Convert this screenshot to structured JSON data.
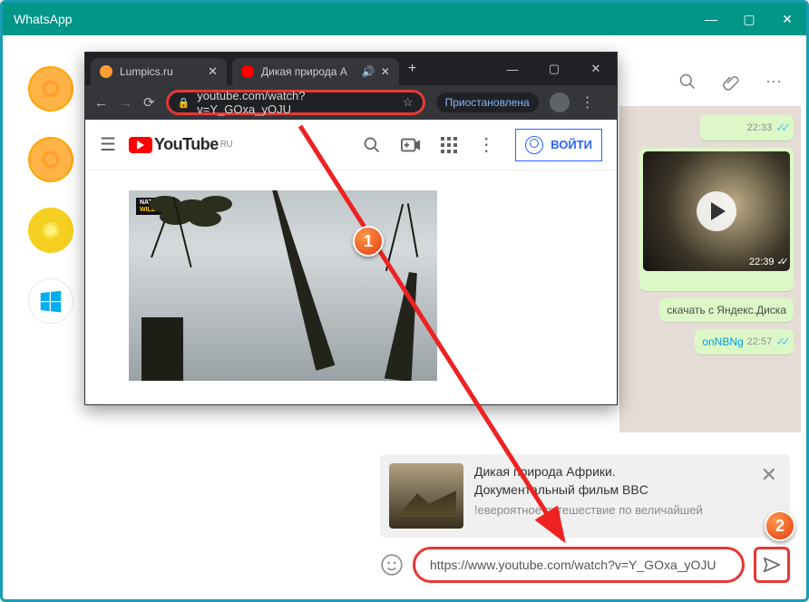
{
  "whatsapp": {
    "title": "WhatsApp",
    "top_icons": {
      "search": "search-icon",
      "attach": "paperclip-icon",
      "menu": "kebab"
    }
  },
  "messages": {
    "m1": {
      "time": "22:33"
    },
    "video": {
      "duration": "22:39"
    },
    "yandex": {
      "text": "скачать с Яндекс.Диска"
    },
    "link": {
      "text": "onNBNg",
      "time": "22:57"
    }
  },
  "preview": {
    "title_l1": "Дикая природа Африки.",
    "title_l2": "Документальный фильм BBC",
    "sub": "!евероятное путешествие по величайшей"
  },
  "input": {
    "value": "https://www.youtube.com/watch?v=Y_GOxa_yOJU"
  },
  "chrome": {
    "tab1": "Lumpics.ru",
    "tab2": "Дикая природа А",
    "url": "youtube.com/watch?v=Y_GOxa_yOJU",
    "paused": "Приостановлена"
  },
  "youtube": {
    "brand": "YouTube",
    "region": "RU",
    "signin": "ВОЙТИ",
    "watermark_top": "NAT GEO",
    "watermark_bottom": "WILD HD"
  },
  "badges": {
    "b1": "1",
    "b2": "2"
  }
}
